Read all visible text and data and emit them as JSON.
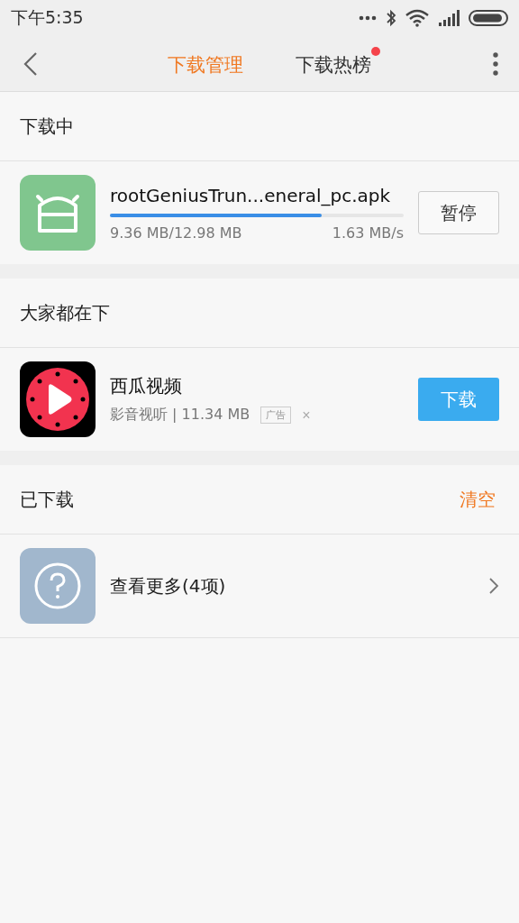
{
  "status_bar": {
    "time": "下午5:35"
  },
  "tabs": [
    {
      "label": "下载管理",
      "selected": true,
      "dot": false
    },
    {
      "label": "下载热榜",
      "selected": false,
      "dot": true
    }
  ],
  "downloading": {
    "heading": "下载中",
    "items": [
      {
        "name": "rootGeniusTrun...eneral_pc.apk",
        "level": 0.72,
        "progress": "9.36 MB/12.98 MB",
        "speed": "1.63 MB/s",
        "action": "暂停"
      }
    ]
  },
  "popular": {
    "heading": "大家都在下",
    "items": [
      {
        "name": "西瓜视频",
        "meta": "影音视听 | 11.34 MB",
        "ad_label": "广告",
        "dismiss": "×",
        "action": "下载"
      }
    ]
  },
  "downloaded": {
    "heading": "已下载",
    "clear": "清空",
    "more": "查看更多(4项)"
  }
}
